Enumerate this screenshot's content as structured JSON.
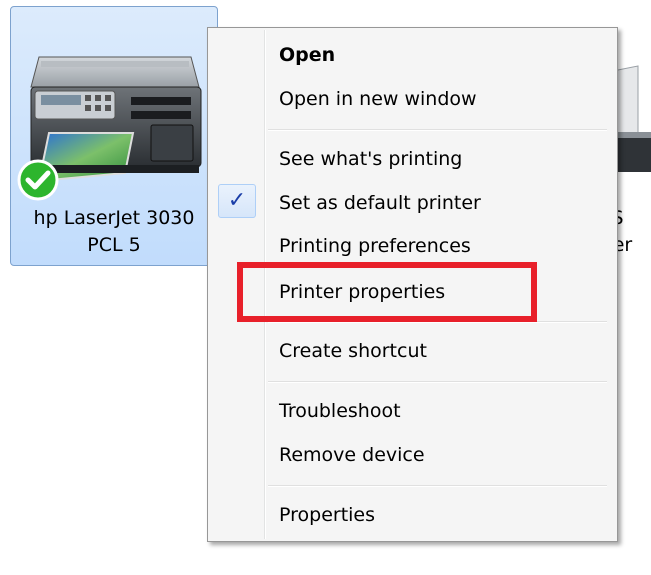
{
  "printer_tile": {
    "name_line1": "hp LaserJet 3030",
    "name_line2": "PCL 5",
    "icon": "printer-icon",
    "default_badge_icon": "check-circle-icon",
    "badge_color": "#2db52d"
  },
  "second_printer": {
    "label_line1": "PS",
    "label_line2": "iter"
  },
  "context_menu": {
    "items": [
      {
        "label": "Open",
        "bold": true
      },
      {
        "label": "Open in new window"
      },
      {
        "label": "See what's printing"
      },
      {
        "label": "Set as default printer",
        "checked": true
      },
      {
        "label": "Printing preferences"
      },
      {
        "label": "Printer properties",
        "highlighted": true
      },
      {
        "label": "Create shortcut"
      },
      {
        "label": "Troubleshoot"
      },
      {
        "label": "Remove device"
      },
      {
        "label": "Properties"
      }
    ],
    "check_glyph": "✓",
    "check_color": "#1a3ea8"
  },
  "highlight_color": "#e8202a"
}
